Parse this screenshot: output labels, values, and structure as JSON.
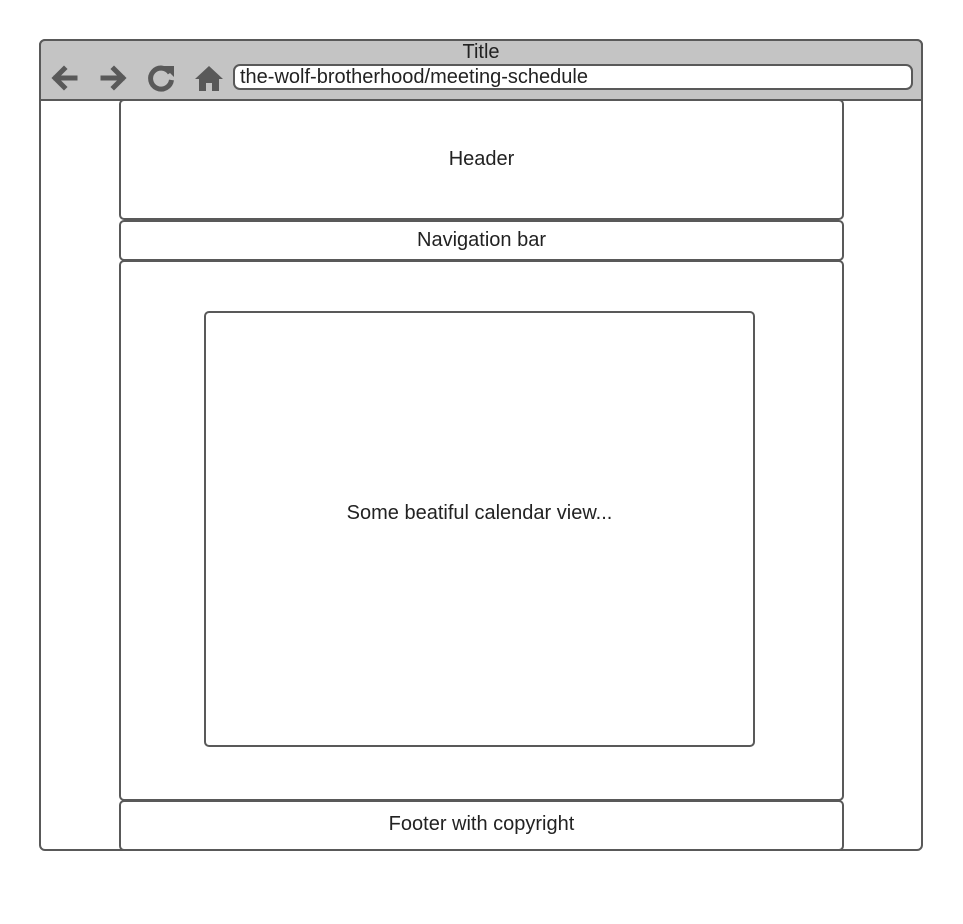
{
  "browser": {
    "title": "Title",
    "url": "the-wolf-brotherhood/meeting-schedule",
    "icons": [
      "back-arrow-icon",
      "forward-arrow-icon",
      "reload-icon",
      "home-icon"
    ]
  },
  "page": {
    "header": "Header",
    "navigation": "Navigation bar",
    "calendar": "Some beatiful calendar view...",
    "footer": "Footer with copyright"
  },
  "colors": {
    "stroke": "#595959",
    "titlebar": "#c4c4c4",
    "text": "#222222",
    "background": "#ffffff"
  }
}
